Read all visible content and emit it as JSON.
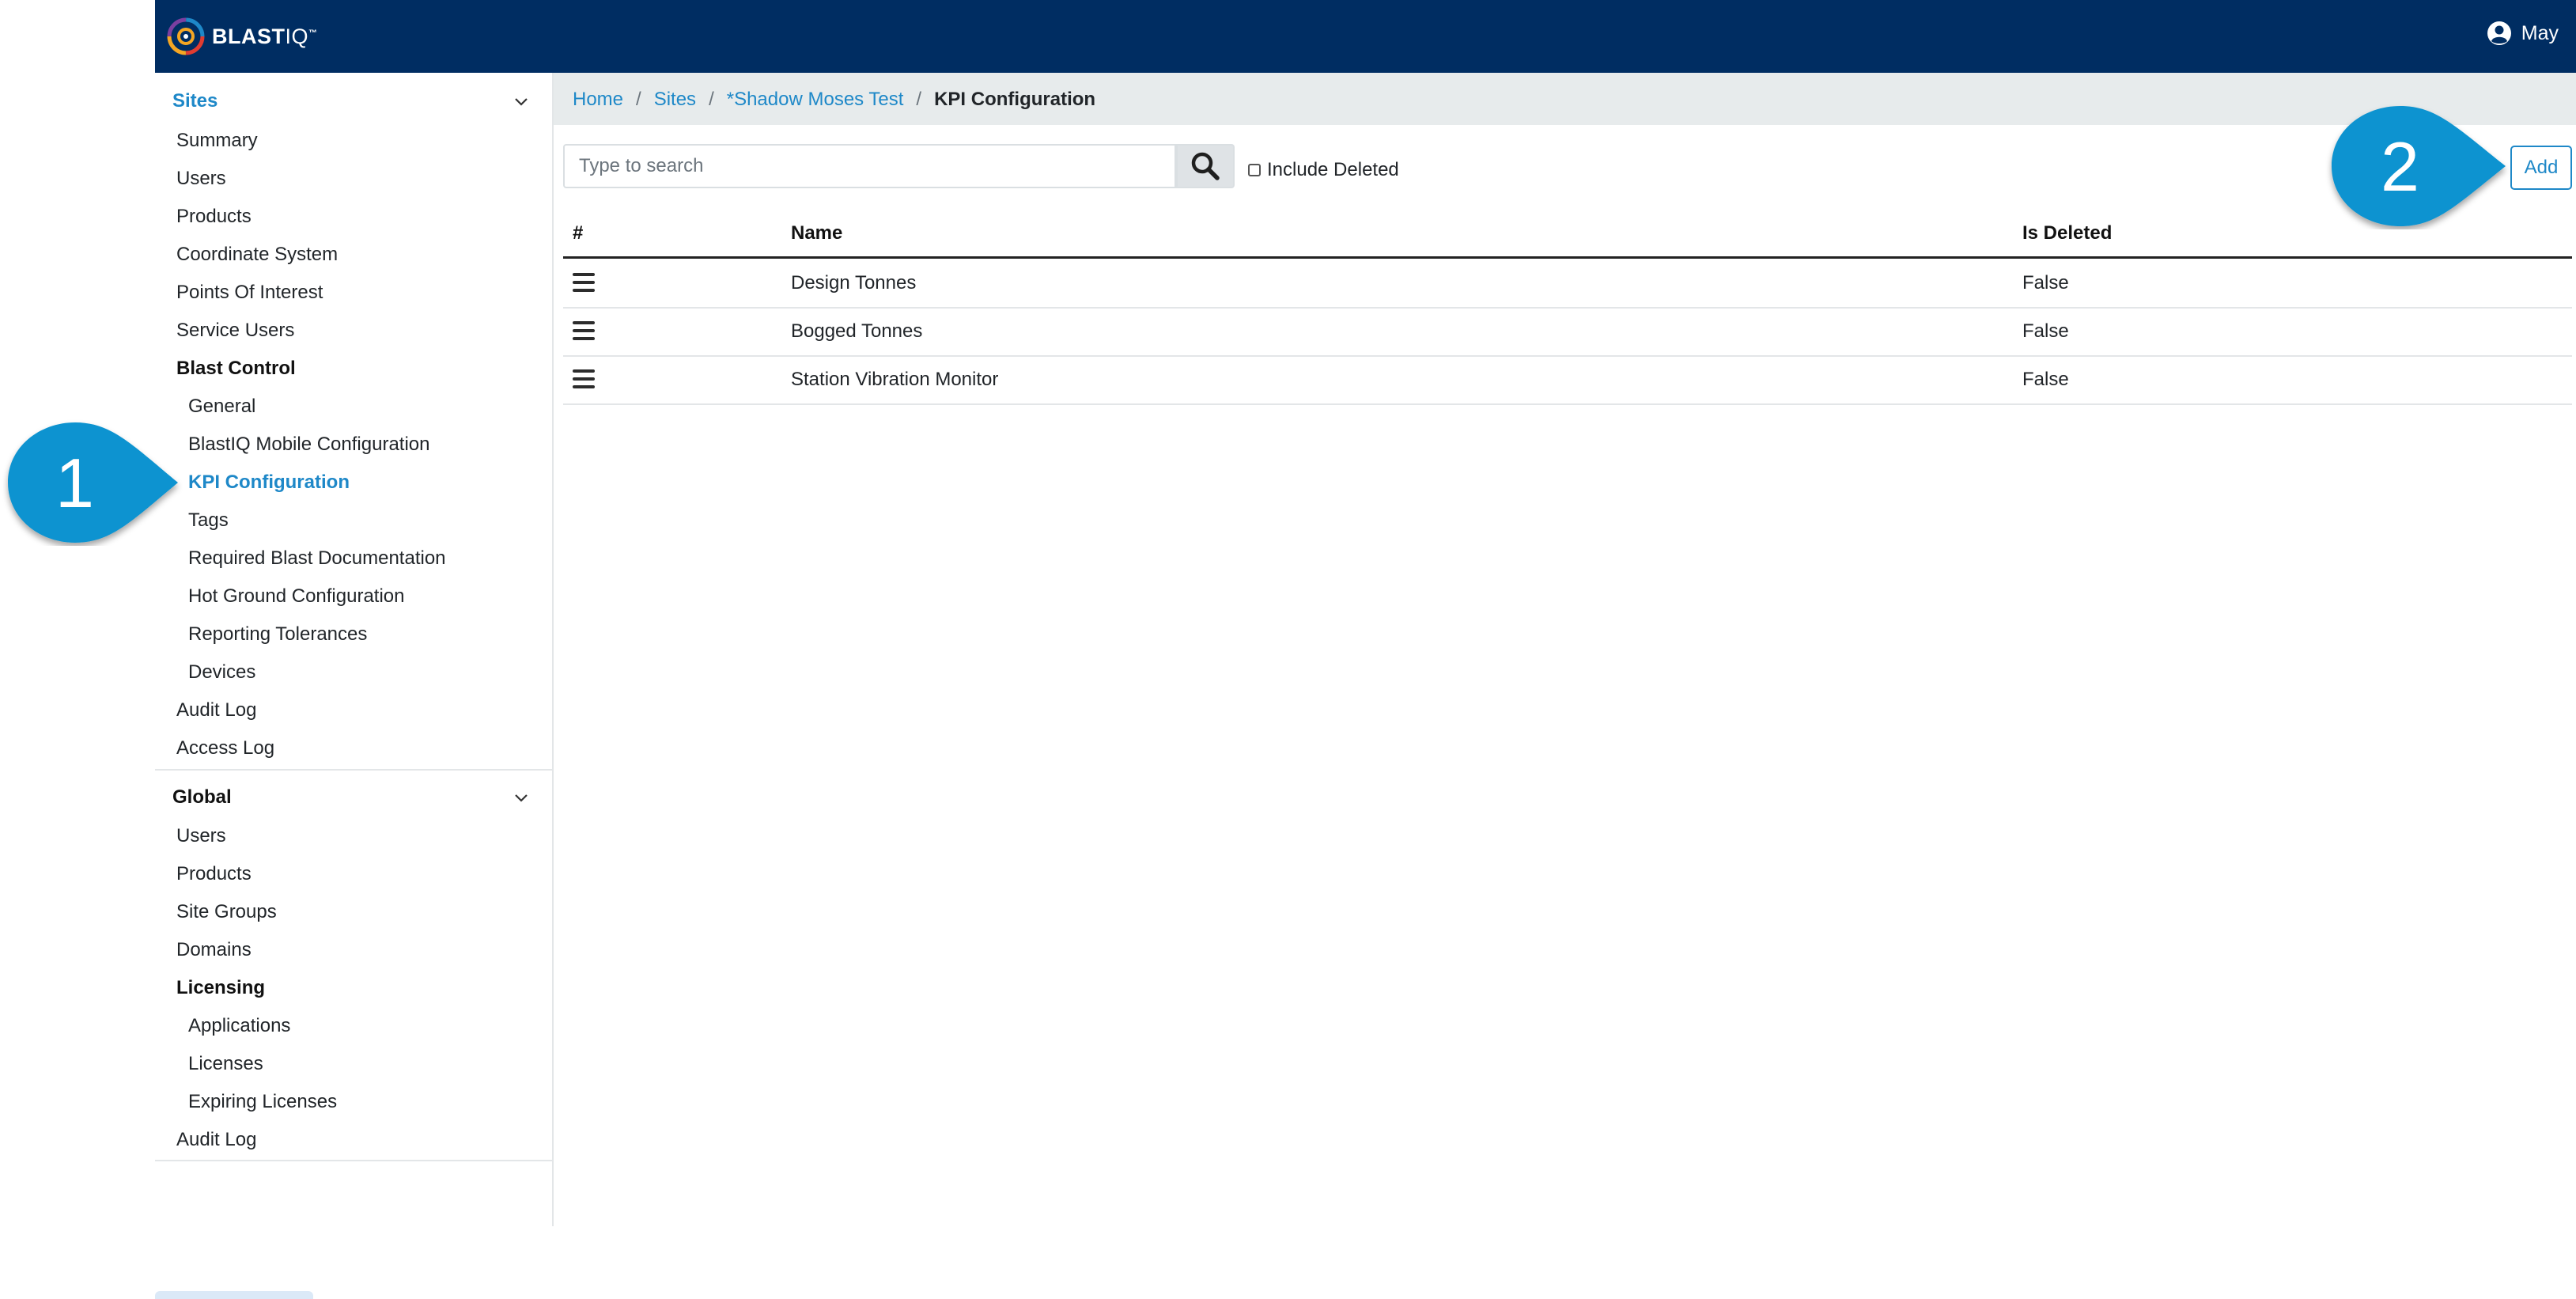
{
  "header": {
    "brand_main": "BLAST",
    "brand_suffix": "IQ",
    "brand_tm": "™",
    "user_name": "May"
  },
  "sidebar": {
    "sites_title": "Sites",
    "sites_items": [
      {
        "label": "Summary"
      },
      {
        "label": "Users"
      },
      {
        "label": "Products"
      },
      {
        "label": "Coordinate System"
      },
      {
        "label": "Points Of Interest"
      },
      {
        "label": "Service Users"
      }
    ],
    "blast_control_title": "Blast Control",
    "blast_control_items": [
      {
        "label": "General"
      },
      {
        "label": "BlastIQ Mobile Configuration"
      },
      {
        "label": "KPI Configuration"
      },
      {
        "label": "Tags"
      },
      {
        "label": "Required Blast Documentation"
      },
      {
        "label": "Hot Ground Configuration"
      },
      {
        "label": "Reporting Tolerances"
      },
      {
        "label": "Devices"
      }
    ],
    "sites_tail_items": [
      {
        "label": "Audit Log"
      },
      {
        "label": "Access Log"
      }
    ],
    "global_title": "Global",
    "global_items": [
      {
        "label": "Users"
      },
      {
        "label": "Products"
      },
      {
        "label": "Site Groups"
      },
      {
        "label": "Domains"
      }
    ],
    "licensing_title": "Licensing",
    "licensing_items": [
      {
        "label": "Applications"
      },
      {
        "label": "Licenses"
      },
      {
        "label": "Expiring Licenses"
      }
    ],
    "global_tail_items": [
      {
        "label": "Audit Log"
      }
    ]
  },
  "breadcrumb": {
    "home": "Home",
    "sites": "Sites",
    "site": "*Shadow Moses Test",
    "current": "KPI Configuration",
    "separator": "/"
  },
  "toolbar": {
    "search_placeholder": "Type to search",
    "search_value": "",
    "include_deleted_label": "Include Deleted",
    "include_deleted_checked": false,
    "add_label": "Add"
  },
  "table": {
    "headers": [
      "#",
      "Name",
      "Is Deleted"
    ],
    "rows": [
      {
        "name": "Design Tonnes",
        "is_deleted": "False"
      },
      {
        "name": "Bogged Tonnes",
        "is_deleted": "False"
      },
      {
        "name": "Station Vibration Monitor",
        "is_deleted": "False"
      }
    ]
  },
  "callouts": {
    "first": "1",
    "second": "2",
    "color": "#0a93d0"
  },
  "colors": {
    "topbar": "#002d62",
    "accent": "#1e88c8",
    "breadcrumb_bg": "#e7ebec"
  }
}
